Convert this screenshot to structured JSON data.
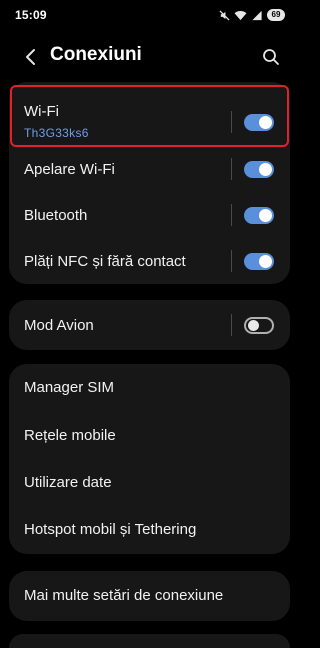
{
  "status_bar": {
    "time": "15:09",
    "battery": "69"
  },
  "header": {
    "title": "Conexiuni"
  },
  "connections": {
    "wifi": {
      "label": "Wi-Fi",
      "network": "Th3G33ks6",
      "enabled": true
    },
    "wifi_calling": {
      "label": "Apelare Wi-Fi",
      "enabled": true
    },
    "bluetooth": {
      "label": "Bluetooth",
      "enabled": true
    },
    "nfc": {
      "label": "Plăți NFC și fără contact",
      "enabled": true
    }
  },
  "airplane": {
    "label": "Mod Avion",
    "enabled": false
  },
  "network_items": [
    "Manager SIM",
    "Rețele mobile",
    "Utilizare date",
    "Hotspot mobil și Tethering"
  ],
  "more": {
    "label": "Mai multe setări de conexiune"
  },
  "colors": {
    "background": "#000000",
    "card": "#171717",
    "accent": "#5a8fdc",
    "subtitle": "#6f9ee8",
    "highlight": "#e3212b"
  }
}
